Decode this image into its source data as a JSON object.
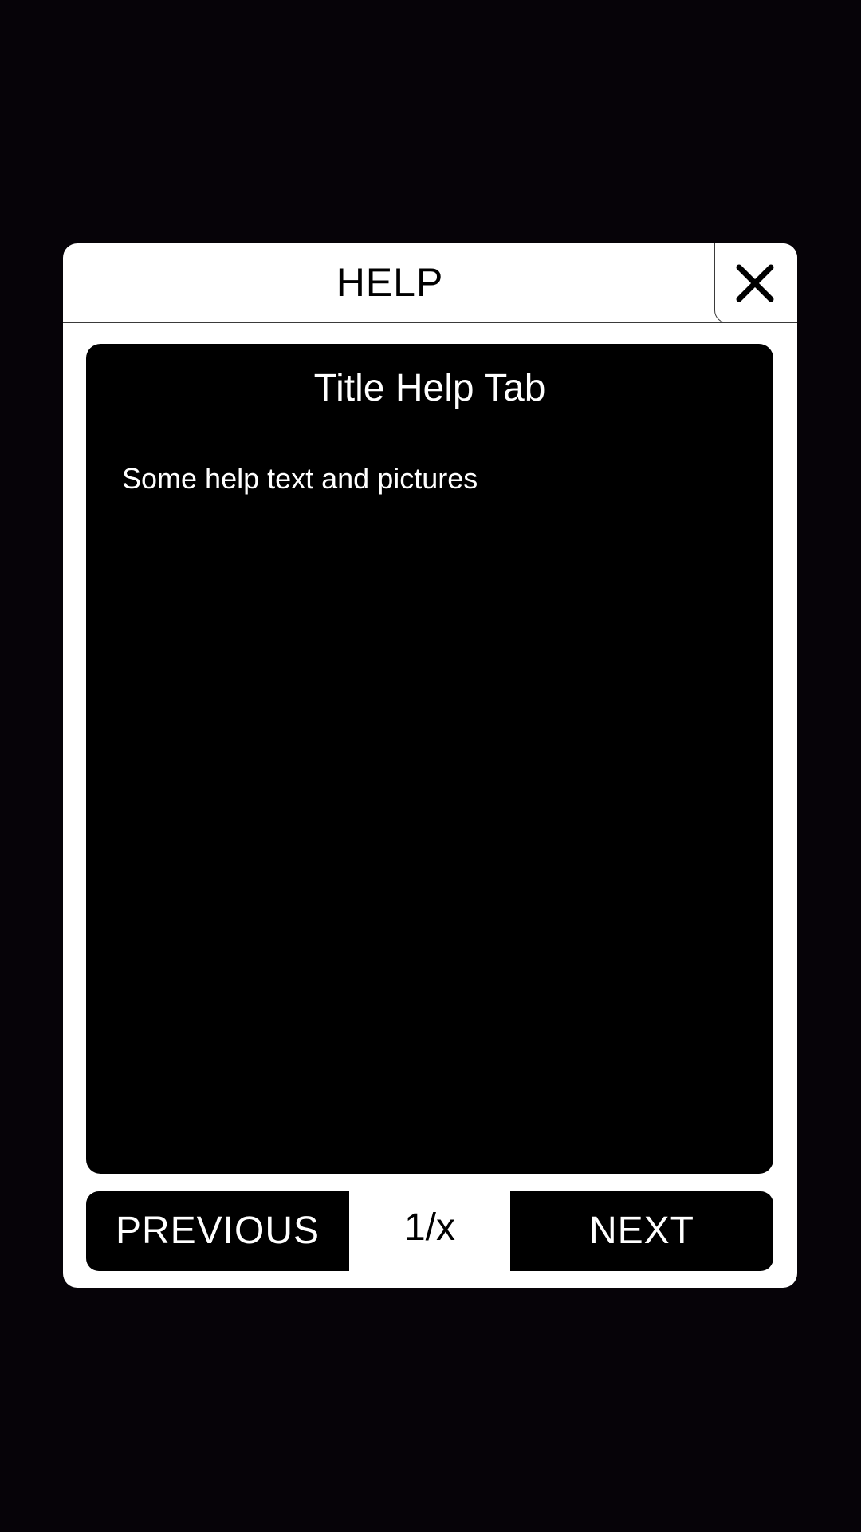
{
  "dialog": {
    "title": "HELP",
    "close_icon": "close-icon"
  },
  "content": {
    "title": "Title Help Tab",
    "body": "Some help text and pictures"
  },
  "footer": {
    "previous_label": "PREVIOUS",
    "page_indicator": "1/x",
    "next_label": "NEXT"
  },
  "colors": {
    "background": "#060308",
    "dialog": "#ffffff",
    "panel": "#000000",
    "text_on_panel": "#ffffff"
  }
}
